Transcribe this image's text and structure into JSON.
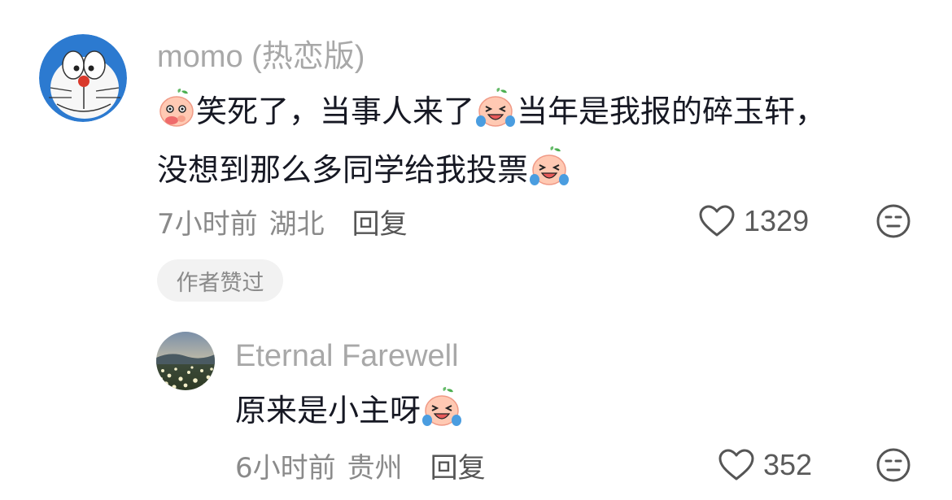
{
  "comment": {
    "author": "momo (热恋版)",
    "line1_a": "笑死了，当事人来了",
    "line1_b": "当年是我报的碎玉轩，",
    "line2": "没想到那么多同学给我投票",
    "time": "7小时前",
    "location": "湖北",
    "reply_label": "回复",
    "likes": "1329",
    "author_liked_badge": "作者赞过"
  },
  "reply": {
    "author": "Eternal Farewell",
    "text": "原来是小主呀",
    "time": "6小时前",
    "location": "贵州",
    "reply_label": "回复",
    "likes": "352"
  },
  "icons": {
    "emoji_covering_mouth": "peach-face-covering-mouth-emoji",
    "emoji_crying_laughing": "peach-face-crying-laughing-emoji",
    "like": "heart-outline-icon",
    "reaction": "expressionless-face-icon"
  },
  "colors": {
    "primary_text": "#161823",
    "username": "#a8a8a8",
    "meta": "#8a8a8a",
    "badge_bg": "#f2f2f2"
  }
}
